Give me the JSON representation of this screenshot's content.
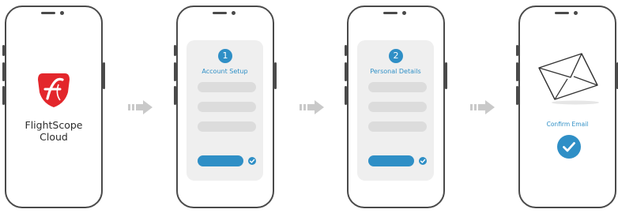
{
  "colors": {
    "accent": "#2f8fc6",
    "logo_red": "#e3262b",
    "frame": "#4a4a4a",
    "field": "#dcdcdc",
    "card": "#efefef"
  },
  "screen1": {
    "brand_line1": "FlightScope",
    "brand_line2": "Cloud",
    "logo_icon": "flightscope-logo-icon"
  },
  "screen2": {
    "step_number": "1",
    "title": "Account Setup"
  },
  "screen3": {
    "step_number": "2",
    "title": "Personal Details"
  },
  "screen4": {
    "title": "Confirm Email",
    "icon": "envelope-icon"
  }
}
